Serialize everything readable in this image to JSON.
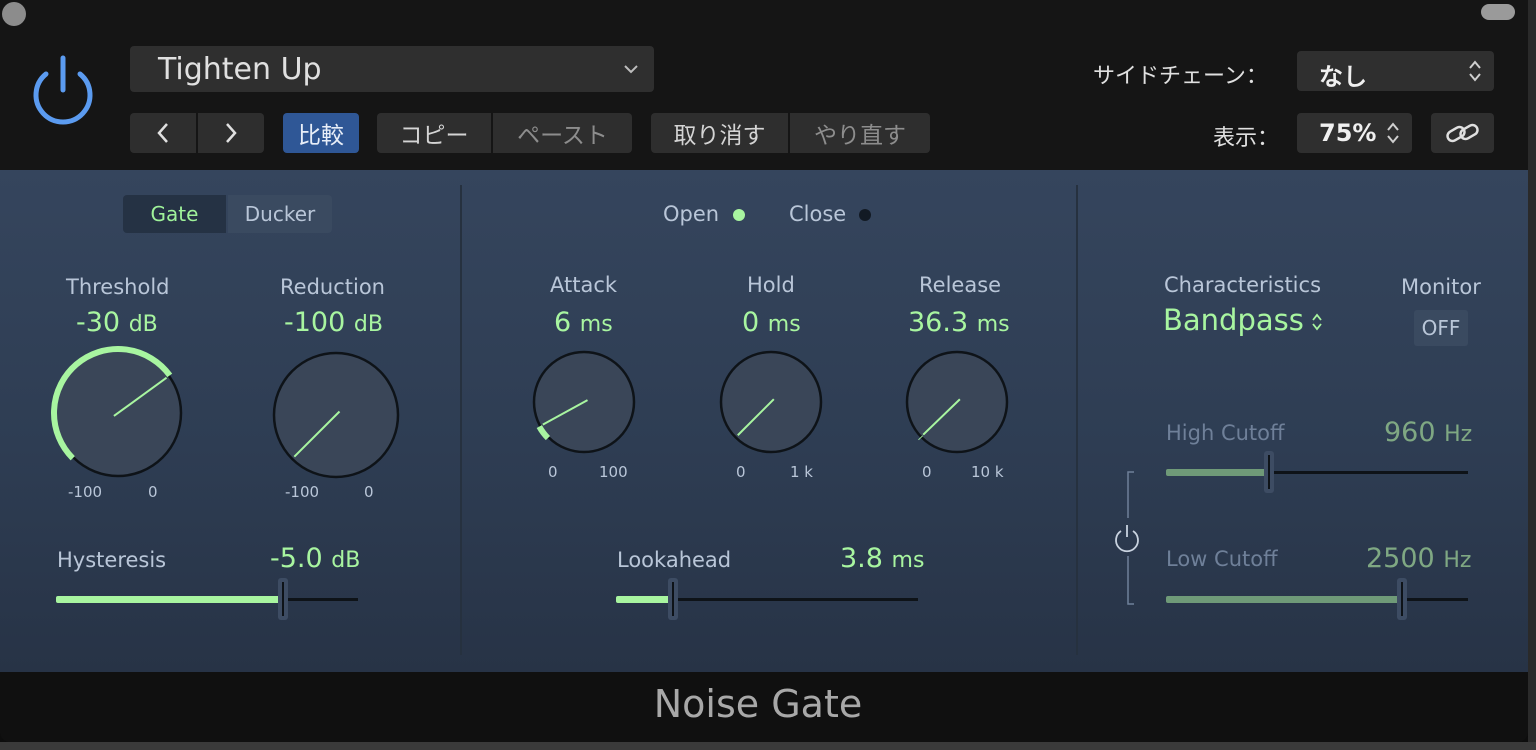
{
  "header": {
    "preset_name": "Tighten Up",
    "prev_label": "<",
    "next_label": ">",
    "compare_label": "比較",
    "copy_label": "コピー",
    "paste_label": "ペースト",
    "undo_label": "取り消す",
    "redo_label": "やり直す",
    "sidechain_label": "サイドチェーン：",
    "sidechain_value": "なし",
    "view_label": "表示：",
    "view_value": "75%"
  },
  "mode": {
    "options": [
      "Gate",
      "Ducker"
    ],
    "selected": "Gate"
  },
  "indicators": {
    "open_label": "Open",
    "close_label": "Close",
    "open_active": true
  },
  "threshold": {
    "label": "Threshold",
    "value": "-30",
    "unit": "dB",
    "min_label": "-100",
    "max_label": "0",
    "min": -100,
    "max": 0,
    "current": -30
  },
  "reduction": {
    "label": "Reduction",
    "value": "-100",
    "unit": "dB",
    "min_label": "-100",
    "max_label": "0",
    "min": -100,
    "max": 0,
    "current": -100
  },
  "attack": {
    "label": "Attack",
    "value": "6",
    "unit": "ms",
    "min_label": "0",
    "max_label": "100",
    "min": 0,
    "max": 100,
    "current": 6
  },
  "hold": {
    "label": "Hold",
    "value": "0",
    "unit": "ms",
    "min_label": "0",
    "max_label": "1 k",
    "min": 0,
    "max": 1000,
    "current": 0
  },
  "release": {
    "label": "Release",
    "value": "36.3",
    "unit": "ms",
    "min_label": "0",
    "max_label": "10 k",
    "min": 0,
    "max": 10000,
    "current": 36.3
  },
  "hysteresis": {
    "label": "Hysteresis",
    "value": "-5.0",
    "unit": "dB",
    "fraction": 0.75
  },
  "lookahead": {
    "label": "Lookahead",
    "value": "3.8",
    "unit": "ms",
    "fraction": 0.19
  },
  "characteristics": {
    "label": "Characteristics",
    "value": "Bandpass"
  },
  "monitor": {
    "label": "Monitor",
    "value": "OFF"
  },
  "high_cutoff": {
    "label": "High Cutoff",
    "value": "960",
    "unit": "Hz",
    "fraction": 0.34
  },
  "low_cutoff": {
    "label": "Low Cutoff",
    "value": "2500",
    "unit": "Hz",
    "fraction": 0.78
  },
  "plugin_name": "Noise Gate",
  "colors": {
    "accent": "#a8f5a0",
    "panel": "#2e3d53",
    "compare_blue": "#2f5796"
  }
}
